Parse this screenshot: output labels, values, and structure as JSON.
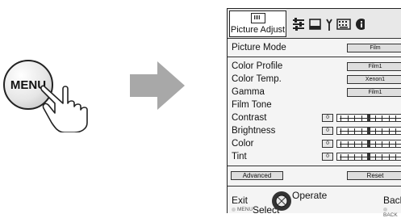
{
  "menu_button": {
    "label": "MENU"
  },
  "icons": {
    "hand": "hand-pointer-icon",
    "arrow": "arrow-right-icon",
    "tab_picture": "picture-icon",
    "tab_sliders": "sliders-icon",
    "tab_display": "display-icon",
    "tab_install": "antenna-icon",
    "tab_function": "keyboard-icon",
    "tab_info": "info-icon",
    "select": "dial-icon"
  },
  "osd": {
    "active_tab": "Picture Adjust",
    "picture_mode": {
      "label": "Picture Mode",
      "value": "Film"
    },
    "settings": [
      {
        "label": "Color Profile",
        "value": "Film1"
      },
      {
        "label": "Color Temp.",
        "value": "Xenon1"
      },
      {
        "label": "Gamma",
        "value": "Film1"
      },
      {
        "label": "Film Tone",
        "value": ""
      }
    ],
    "sliders": [
      {
        "label": "Contrast",
        "number": "0",
        "level": 0.5
      },
      {
        "label": "Brightness",
        "number": "0",
        "level": 0.5
      },
      {
        "label": "Color",
        "number": "0",
        "level": 0.5
      },
      {
        "label": "Tint",
        "number": "0",
        "level": 0.5
      }
    ],
    "buttons": {
      "advanced": "Advanced",
      "reset": "Reset"
    },
    "footer": {
      "exit": "Exit",
      "exit_key": "MENU",
      "select": "Select",
      "operate": "Operate",
      "back": "Back",
      "back_key": "BACK"
    }
  },
  "colors": {
    "panel_bg": "#f4f4f4",
    "value_box": "#dedede",
    "arrow": "#a8a8a8"
  }
}
